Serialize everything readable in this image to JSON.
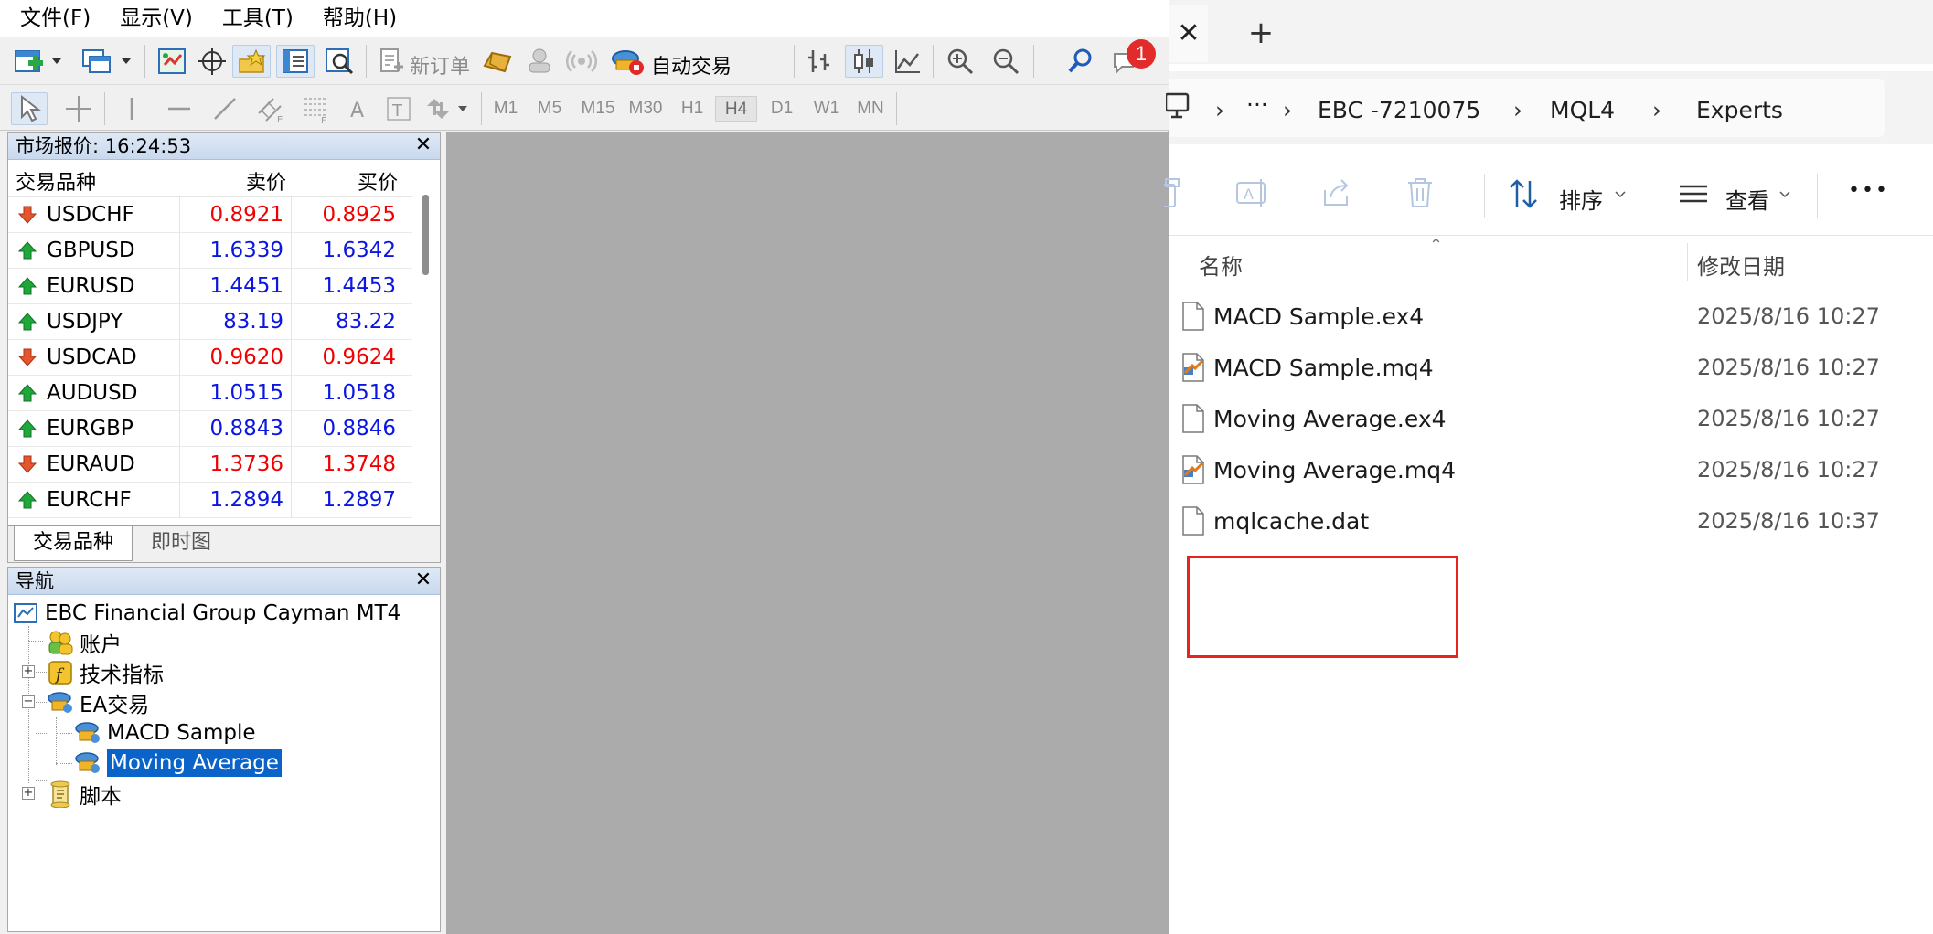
{
  "mt4": {
    "menu": [
      "文件(F)",
      "显示(V)",
      "工具(T)",
      "帮助(H)"
    ],
    "toolbar": {
      "new_order": "新订单",
      "auto_trading": "自动交易",
      "notification_count": "1"
    },
    "timeframes": [
      "M1",
      "M5",
      "M15",
      "M30",
      "H1",
      "H4",
      "D1",
      "W1",
      "MN"
    ],
    "timeframe_selected": "H4",
    "market_watch": {
      "title": "市场报价: 16:24:53",
      "col_symbol": "交易品种",
      "col_bid": "卖价",
      "col_ask": "买价",
      "rows": [
        {
          "symbol": "USDCHF",
          "bid": "0.8921",
          "ask": "0.8925",
          "dir": "down"
        },
        {
          "symbol": "GBPUSD",
          "bid": "1.6339",
          "ask": "1.6342",
          "dir": "up"
        },
        {
          "symbol": "EURUSD",
          "bid": "1.4451",
          "ask": "1.4453",
          "dir": "up"
        },
        {
          "symbol": "USDJPY",
          "bid": "83.19",
          "ask": "83.22",
          "dir": "up"
        },
        {
          "symbol": "USDCAD",
          "bid": "0.9620",
          "ask": "0.9624",
          "dir": "down"
        },
        {
          "symbol": "AUDUSD",
          "bid": "1.0515",
          "ask": "1.0518",
          "dir": "up"
        },
        {
          "symbol": "EURGBP",
          "bid": "0.8843",
          "ask": "0.8846",
          "dir": "up"
        },
        {
          "symbol": "EURAUD",
          "bid": "1.3736",
          "ask": "1.3748",
          "dir": "down"
        },
        {
          "symbol": "EURCHF",
          "bid": "1.2894",
          "ask": "1.2897",
          "dir": "up"
        }
      ],
      "tabs": [
        "交易品种",
        "即时图"
      ]
    },
    "navigator": {
      "title": "导航",
      "root": "EBC Financial Group Cayman MT4",
      "accounts": "账户",
      "indicators": "技术指标",
      "experts": "EA交易",
      "expert_items": [
        "MACD Sample",
        "Moving Average"
      ],
      "scripts": "脚本"
    }
  },
  "explorer": {
    "close": "✕",
    "new_tab": "+",
    "breadcrumb": [
      "EBC  -7210075",
      "MQL4",
      "Experts"
    ],
    "sort_label": "排序",
    "view_label": "查看",
    "more": "•••",
    "col_name": "名称",
    "col_modified": "修改日期",
    "files": [
      {
        "name": "MACD Sample.ex4",
        "date": "2025/8/16 10:27",
        "type": "ex4"
      },
      {
        "name": "MACD Sample.mq4",
        "date": "2025/8/16 10:27",
        "type": "mq4"
      },
      {
        "name": "Moving Average.ex4",
        "date": "2025/8/16 10:27",
        "type": "ex4"
      },
      {
        "name": "Moving Average.mq4",
        "date": "2025/8/16 10:27",
        "type": "mq4"
      },
      {
        "name": "mqlcache.dat",
        "date": "2025/8/16 10:37",
        "type": "dat"
      }
    ],
    "highlight_color": "#e8221d"
  }
}
